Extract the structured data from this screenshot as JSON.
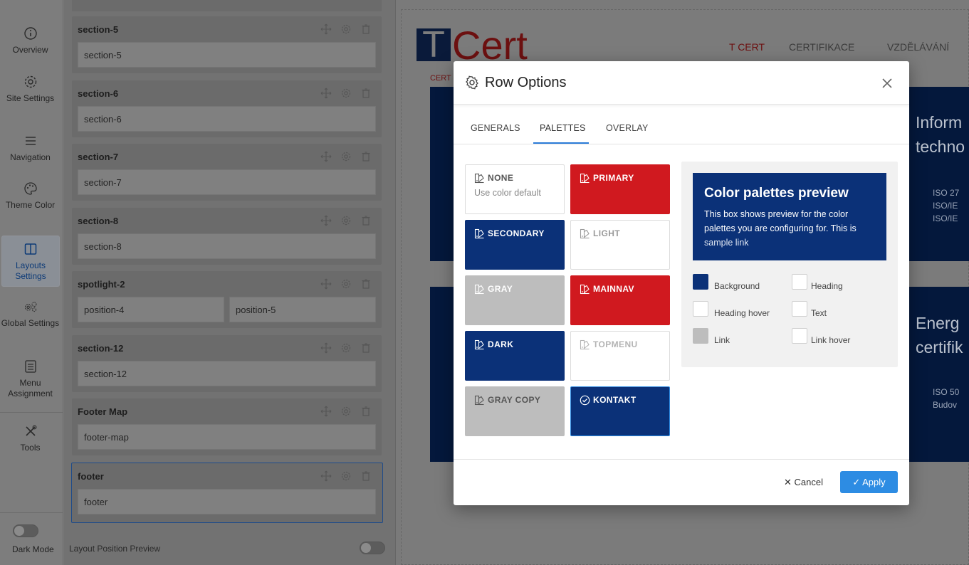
{
  "sidebar": {
    "items": [
      {
        "label": "Overview",
        "icon": "info-icon"
      },
      {
        "label": "Site Settings",
        "icon": "gear-icon"
      },
      {
        "label": "Navigation",
        "icon": "hamburger-icon"
      },
      {
        "label": "Theme Color",
        "icon": "palette-icon"
      },
      {
        "label": "Layouts Settings",
        "icon": "layout-icon"
      },
      {
        "label": "Global Settings",
        "icon": "gears-icon"
      },
      {
        "label": "Menu Assignment",
        "icon": "list-icon"
      },
      {
        "label": "Tools",
        "icon": "tools-icon"
      }
    ],
    "dark_mode_label": "Dark Mode"
  },
  "builder": {
    "sections": [
      {
        "title": "section-5",
        "positions": [
          "section-5"
        ]
      },
      {
        "title": "section-6",
        "positions": [
          "section-6"
        ]
      },
      {
        "title": "section-7",
        "positions": [
          "section-7"
        ]
      },
      {
        "title": "section-8",
        "positions": [
          "section-8"
        ]
      },
      {
        "title": "spotlight-2",
        "positions": [
          "position-4",
          "position-5"
        ]
      },
      {
        "title": "section-12",
        "positions": [
          "section-12"
        ]
      },
      {
        "title": "Footer Map",
        "positions": [
          "footer-map"
        ]
      },
      {
        "title": "footer",
        "positions": [
          "footer"
        ]
      }
    ],
    "layout_position_preview_label": "Layout Position Preview"
  },
  "site": {
    "logo_t": "T",
    "logo_cert": "Cert",
    "nav": [
      "T CERT",
      "CERTIFIKACE",
      "VZDĚLÁVÁNÍ"
    ],
    "box1_heading": [
      "Inform",
      "techno"
    ],
    "box1_list": [
      "ISO 27",
      "ISO/IE",
      "ISO/IE"
    ],
    "box2_heading": [
      "Energ",
      "certifik"
    ],
    "box2_list": [
      "ISO 50",
      "Budov"
    ],
    "cert_small": "CERT"
  },
  "modal": {
    "title": "Row Options",
    "tabs": [
      "GENERALS",
      "PALETTES",
      "OVERLAY"
    ],
    "active_tab": "PALETTES",
    "palettes": [
      {
        "label": "NONE",
        "sub": "Use color default",
        "bg": "#ffffff",
        "fg": "#555555"
      },
      {
        "label": "PRIMARY",
        "sub": "",
        "bg": "#d0191f",
        "fg": "#ffffff"
      },
      {
        "label": "SECONDARY",
        "sub": "",
        "bg": "#0b3178",
        "fg": "#ffffff"
      },
      {
        "label": "LIGHT",
        "sub": "",
        "bg": "#ffffff",
        "fg": "#9a9a9a"
      },
      {
        "label": "GRAY",
        "sub": "",
        "bg": "#bdbdbd",
        "fg": "#ffffff"
      },
      {
        "label": "MAINNAV",
        "sub": "",
        "bg": "#d0191f",
        "fg": "#ffffff"
      },
      {
        "label": "DARK",
        "sub": "",
        "bg": "#0b3178",
        "fg": "#ffffff"
      },
      {
        "label": "TOPMENU",
        "sub": "",
        "bg": "#ffffff",
        "fg": "#b4b4b4"
      },
      {
        "label": "GRAY COPY",
        "sub": "",
        "bg": "#bdbdbd",
        "fg": "#555555"
      },
      {
        "label": "KONTAKT",
        "sub": "",
        "bg": "#0b3178",
        "fg": "#ffffff",
        "selected": true
      }
    ],
    "preview": {
      "title": "Color palettes preview",
      "desc": "This box shows preview for the color palettes you are configuring for. This is",
      "link": "sample link",
      "swatches": [
        {
          "label": "Background",
          "color": "#0b3178"
        },
        {
          "label": "Heading",
          "color": "#ffffff"
        },
        {
          "label": "Heading hover",
          "color": "#ffffff"
        },
        {
          "label": "Text",
          "color": "#ffffff"
        },
        {
          "label": "Link",
          "color": "#bdbdbd"
        },
        {
          "label": "Link hover",
          "color": "#ffffff"
        }
      ]
    },
    "cancel_label": "Cancel",
    "apply_label": "Apply"
  }
}
